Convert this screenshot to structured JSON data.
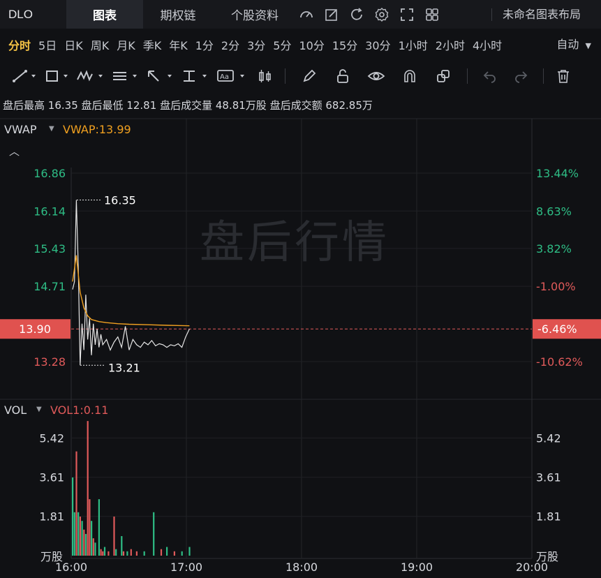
{
  "topbar": {
    "symbol": "DLO",
    "tabs": [
      {
        "label": "图表",
        "active": true
      },
      {
        "label": "期权链",
        "active": false
      },
      {
        "label": "个股资料",
        "active": false
      }
    ],
    "icons": [
      "gauge-icon",
      "edit-icon",
      "refresh-icon",
      "settings-icon",
      "fullscreen-icon",
      "layout-grid-icon"
    ],
    "layout_name": "未命名图表布局"
  },
  "periods": {
    "items": [
      "分时",
      "5日",
      "日K",
      "周K",
      "月K",
      "季K",
      "年K",
      "1分",
      "2分",
      "3分",
      "5分",
      "10分",
      "15分",
      "30分",
      "1小时",
      "2小时",
      "4小时"
    ],
    "active": "分时",
    "mode": "自动"
  },
  "drawbar": {
    "tools": [
      "line-tool-icon",
      "rect-tool-icon",
      "wave-tool-icon",
      "fib-tool-icon",
      "arrow-tool-icon",
      "text-position-icon",
      "text-annotation-icon",
      "candle-tool-icon"
    ],
    "actions": [
      "pen-icon",
      "unlock-icon",
      "eye-icon",
      "magnet-icon",
      "clone-icon",
      "undo-icon",
      "redo-icon",
      "trash-icon"
    ]
  },
  "stats": {
    "high_label": "盘后最高",
    "high": "16.35",
    "low_label": "盘后最低",
    "low": "12.81",
    "volume_label": "盘后成交量",
    "volume": "48.81万股",
    "amount_label": "盘后成交额",
    "amount": "682.85万"
  },
  "price_panel": {
    "indicator": "VWAP",
    "indicator_value": "VWAP:13.99",
    "watermark": "盘后行情",
    "left_ticks": [
      "16.86",
      "16.14",
      "15.43",
      "14.71",
      "13.90",
      "13.28"
    ],
    "right_ticks": [
      "13.44%",
      "8.63%",
      "3.82%",
      "-1.00%",
      "-6.46%",
      "-10.62%"
    ],
    "current_price": "13.90",
    "current_pct": "-6.46%",
    "max_marker": "16.35",
    "min_marker": "13.21"
  },
  "volume_panel": {
    "indicator": "VOL",
    "indicator_value": "VOL1:0.11",
    "ticks": [
      "5.42",
      "3.61",
      "1.81"
    ],
    "unit": "万股"
  },
  "time_axis": [
    "16:00",
    "17:00",
    "18:00",
    "19:00",
    "20:00"
  ],
  "colors": {
    "up": "#e05a5a",
    "down": "#2ebd85",
    "vwap": "#f0a020",
    "price_line": "#e8e8e8",
    "accent": "#f6c445"
  },
  "chart_data": {
    "type": "line",
    "x_range": [
      "16:00",
      "20:00"
    ],
    "price_series": {
      "name": "",
      "x_minutes": [
        0,
        1,
        2,
        3,
        4,
        5,
        6,
        7,
        8,
        9,
        10,
        11,
        12,
        13,
        14,
        15,
        16,
        18,
        20,
        22,
        24,
        26,
        28,
        30,
        32,
        34,
        36,
        38,
        40,
        42,
        44,
        46,
        48,
        50,
        52,
        54,
        56,
        58,
        60,
        62
      ],
      "values": [
        14.65,
        14.8,
        16.35,
        15.1,
        13.21,
        14.0,
        13.5,
        14.55,
        13.7,
        14.1,
        13.4,
        14.0,
        13.6,
        13.9,
        13.55,
        13.8,
        13.6,
        13.7,
        13.5,
        13.65,
        13.75,
        13.55,
        13.95,
        13.5,
        13.7,
        13.6,
        13.55,
        13.65,
        13.6,
        13.68,
        13.58,
        13.62,
        13.6,
        13.55,
        13.6,
        13.58,
        13.62,
        13.55,
        13.75,
        13.9
      ]
    },
    "vwap_series": {
      "name": "VWAP",
      "x_minutes": [
        0,
        2,
        4,
        6,
        8,
        10,
        14,
        18,
        24,
        30,
        40,
        50,
        62
      ],
      "values": [
        14.8,
        15.3,
        14.6,
        14.3,
        14.15,
        14.08,
        14.04,
        14.02,
        14.0,
        13.99,
        13.98,
        13.97,
        13.96
      ]
    },
    "volume_series": {
      "name": "VOL",
      "unit": "万股",
      "bars": [
        {
          "x": 0,
          "v": 3.6,
          "c": "down"
        },
        {
          "x": 1,
          "v": 2.0,
          "c": "down"
        },
        {
          "x": 2,
          "v": 4.8,
          "c": "up"
        },
        {
          "x": 3,
          "v": 2.0,
          "c": "down"
        },
        {
          "x": 4,
          "v": 1.8,
          "c": "up"
        },
        {
          "x": 5,
          "v": 1.6,
          "c": "down"
        },
        {
          "x": 6,
          "v": 1.2,
          "c": "up"
        },
        {
          "x": 7,
          "v": 1.0,
          "c": "down"
        },
        {
          "x": 8,
          "v": 6.2,
          "c": "up"
        },
        {
          "x": 9,
          "v": 2.6,
          "c": "up"
        },
        {
          "x": 10,
          "v": 1.6,
          "c": "down"
        },
        {
          "x": 11,
          "v": 0.8,
          "c": "up"
        },
        {
          "x": 12,
          "v": 0.6,
          "c": "down"
        },
        {
          "x": 14,
          "v": 2.6,
          "c": "down"
        },
        {
          "x": 15,
          "v": 0.3,
          "c": "up"
        },
        {
          "x": 16,
          "v": 0.2,
          "c": "up"
        },
        {
          "x": 17,
          "v": 0.4,
          "c": "down"
        },
        {
          "x": 19,
          "v": 0.2,
          "c": "up"
        },
        {
          "x": 22,
          "v": 1.8,
          "c": "up"
        },
        {
          "x": 23,
          "v": 0.3,
          "c": "down"
        },
        {
          "x": 26,
          "v": 0.9,
          "c": "down"
        },
        {
          "x": 27,
          "v": 0.2,
          "c": "up"
        },
        {
          "x": 29,
          "v": 0.2,
          "c": "down"
        },
        {
          "x": 31,
          "v": 0.3,
          "c": "up"
        },
        {
          "x": 34,
          "v": 0.2,
          "c": "up"
        },
        {
          "x": 38,
          "v": 0.2,
          "c": "down"
        },
        {
          "x": 43,
          "v": 2.0,
          "c": "down"
        },
        {
          "x": 47,
          "v": 0.3,
          "c": "up"
        },
        {
          "x": 50,
          "v": 0.4,
          "c": "down"
        },
        {
          "x": 54,
          "v": 0.2,
          "c": "up"
        },
        {
          "x": 58,
          "v": 0.2,
          "c": "down"
        },
        {
          "x": 62,
          "v": 0.4,
          "c": "down"
        }
      ]
    },
    "y_price_range": [
      12.81,
      17.2
    ],
    "y_volume_range": [
      0,
      6.3
    ]
  }
}
